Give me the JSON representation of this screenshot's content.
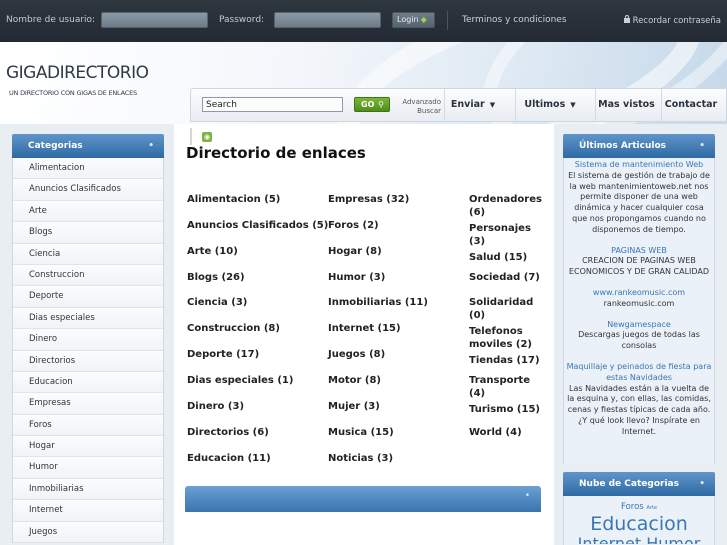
{
  "topbar": {
    "username_label": "Nombre de usuario:",
    "password_label": "Password:",
    "login_label": "Login",
    "terms": "Terminos y condiciones",
    "remember": "Recordar contraseña"
  },
  "header": {
    "logo": "GIGADIRECTORIO",
    "tagline": "UN DIRECTORIO CON GIGAS DE ENLACES"
  },
  "nav": {
    "search_value": "Search",
    "go_label": "GO",
    "advanced_line1": "Advanzado",
    "advanced_line2": "Buscar",
    "items": [
      {
        "label": "Enviar",
        "caret": "▼"
      },
      {
        "label": "Ultimos",
        "caret": "▼"
      },
      {
        "label": "Mas vistos"
      },
      {
        "label": "Contactar"
      }
    ]
  },
  "left": {
    "title": "Categorias",
    "items": [
      "Alimentacion",
      "Anuncios Clasificados",
      "Arte",
      "Blogs",
      "Ciencia",
      "Construccion",
      "Deporte",
      "Dias especiales",
      "Dinero",
      "Directorios",
      "Educacion",
      "Empresas",
      "Foros",
      "Hogar",
      "Humor",
      "Inmobiliarias",
      "Internet",
      "Juegos"
    ]
  },
  "main": {
    "title": "Directorio de enlaces",
    "col1": [
      "Alimentacion (5)",
      "Anuncios Clasificados (5)",
      "Arte (10)",
      "Blogs (26)",
      "Ciencia (3)",
      "Construccion (8)",
      "Deporte (17)",
      "Dias especiales (1)",
      "Dinero (3)",
      "Directorios (6)",
      "Educacion (11)"
    ],
    "col2": [
      "Empresas (32)",
      "Foros (2)",
      "Hogar (8)",
      "Humor (3)",
      "Inmobiliarias (11)",
      "Internet (15)",
      "Juegos (8)",
      "Motor (8)",
      "Mujer (3)",
      "Musica (15)",
      "Noticias (3)"
    ],
    "col3": [
      "Ordenadores (6)",
      "Personajes (3)",
      "Salud (15)",
      "Sociedad (7)",
      "Solidaridad (0)",
      "Telefonos moviles (2)",
      "Tiendas (17)",
      "Transporte (4)",
      "Turismo (15)",
      "World (4)"
    ]
  },
  "right": {
    "articles_title": "Últimos Articulos",
    "articles": [
      {
        "title": "Sistema de mantenimiento Web",
        "body": "El sistema de gestión de trabajo de la web mantenimientoweb.net nos permite disponer de una web dinámica y hacer cualquier cosa que nos propongamos cuando no disponemos de tiempo."
      },
      {
        "title": "PAGINAS WEB",
        "body": "CREACION DE PAGINAS WEB ECONOMICOS Y DE GRAN CALIDAD"
      },
      {
        "title": "www.rankeomusic.com",
        "body": "rankeomusic.com"
      },
      {
        "title": "Newgamespace",
        "body": "Descargas juegos de todas las consolas"
      },
      {
        "title": "Maquillaje y peinados de fiesta para estas Navidades",
        "body": "Las Navidades están a la vuelta de la esquina y, con ellas, las comidas, cenas y fiestas típicas de cada año. ¿Y qué look llevo? Inspírate en Internet."
      }
    ],
    "cloud_title": "Nube de Categorias",
    "cloud_small": "Foros",
    "cloud_small_tag": "Arte",
    "cloud_big": "Educacion",
    "cloud_cut": "Internet Humor"
  },
  "colors": {
    "accent_blue": "#2f6aa4",
    "link_blue": "#3b76b3",
    "go_green": "#4e8d1d",
    "topbar_dark": "#2e3640"
  }
}
